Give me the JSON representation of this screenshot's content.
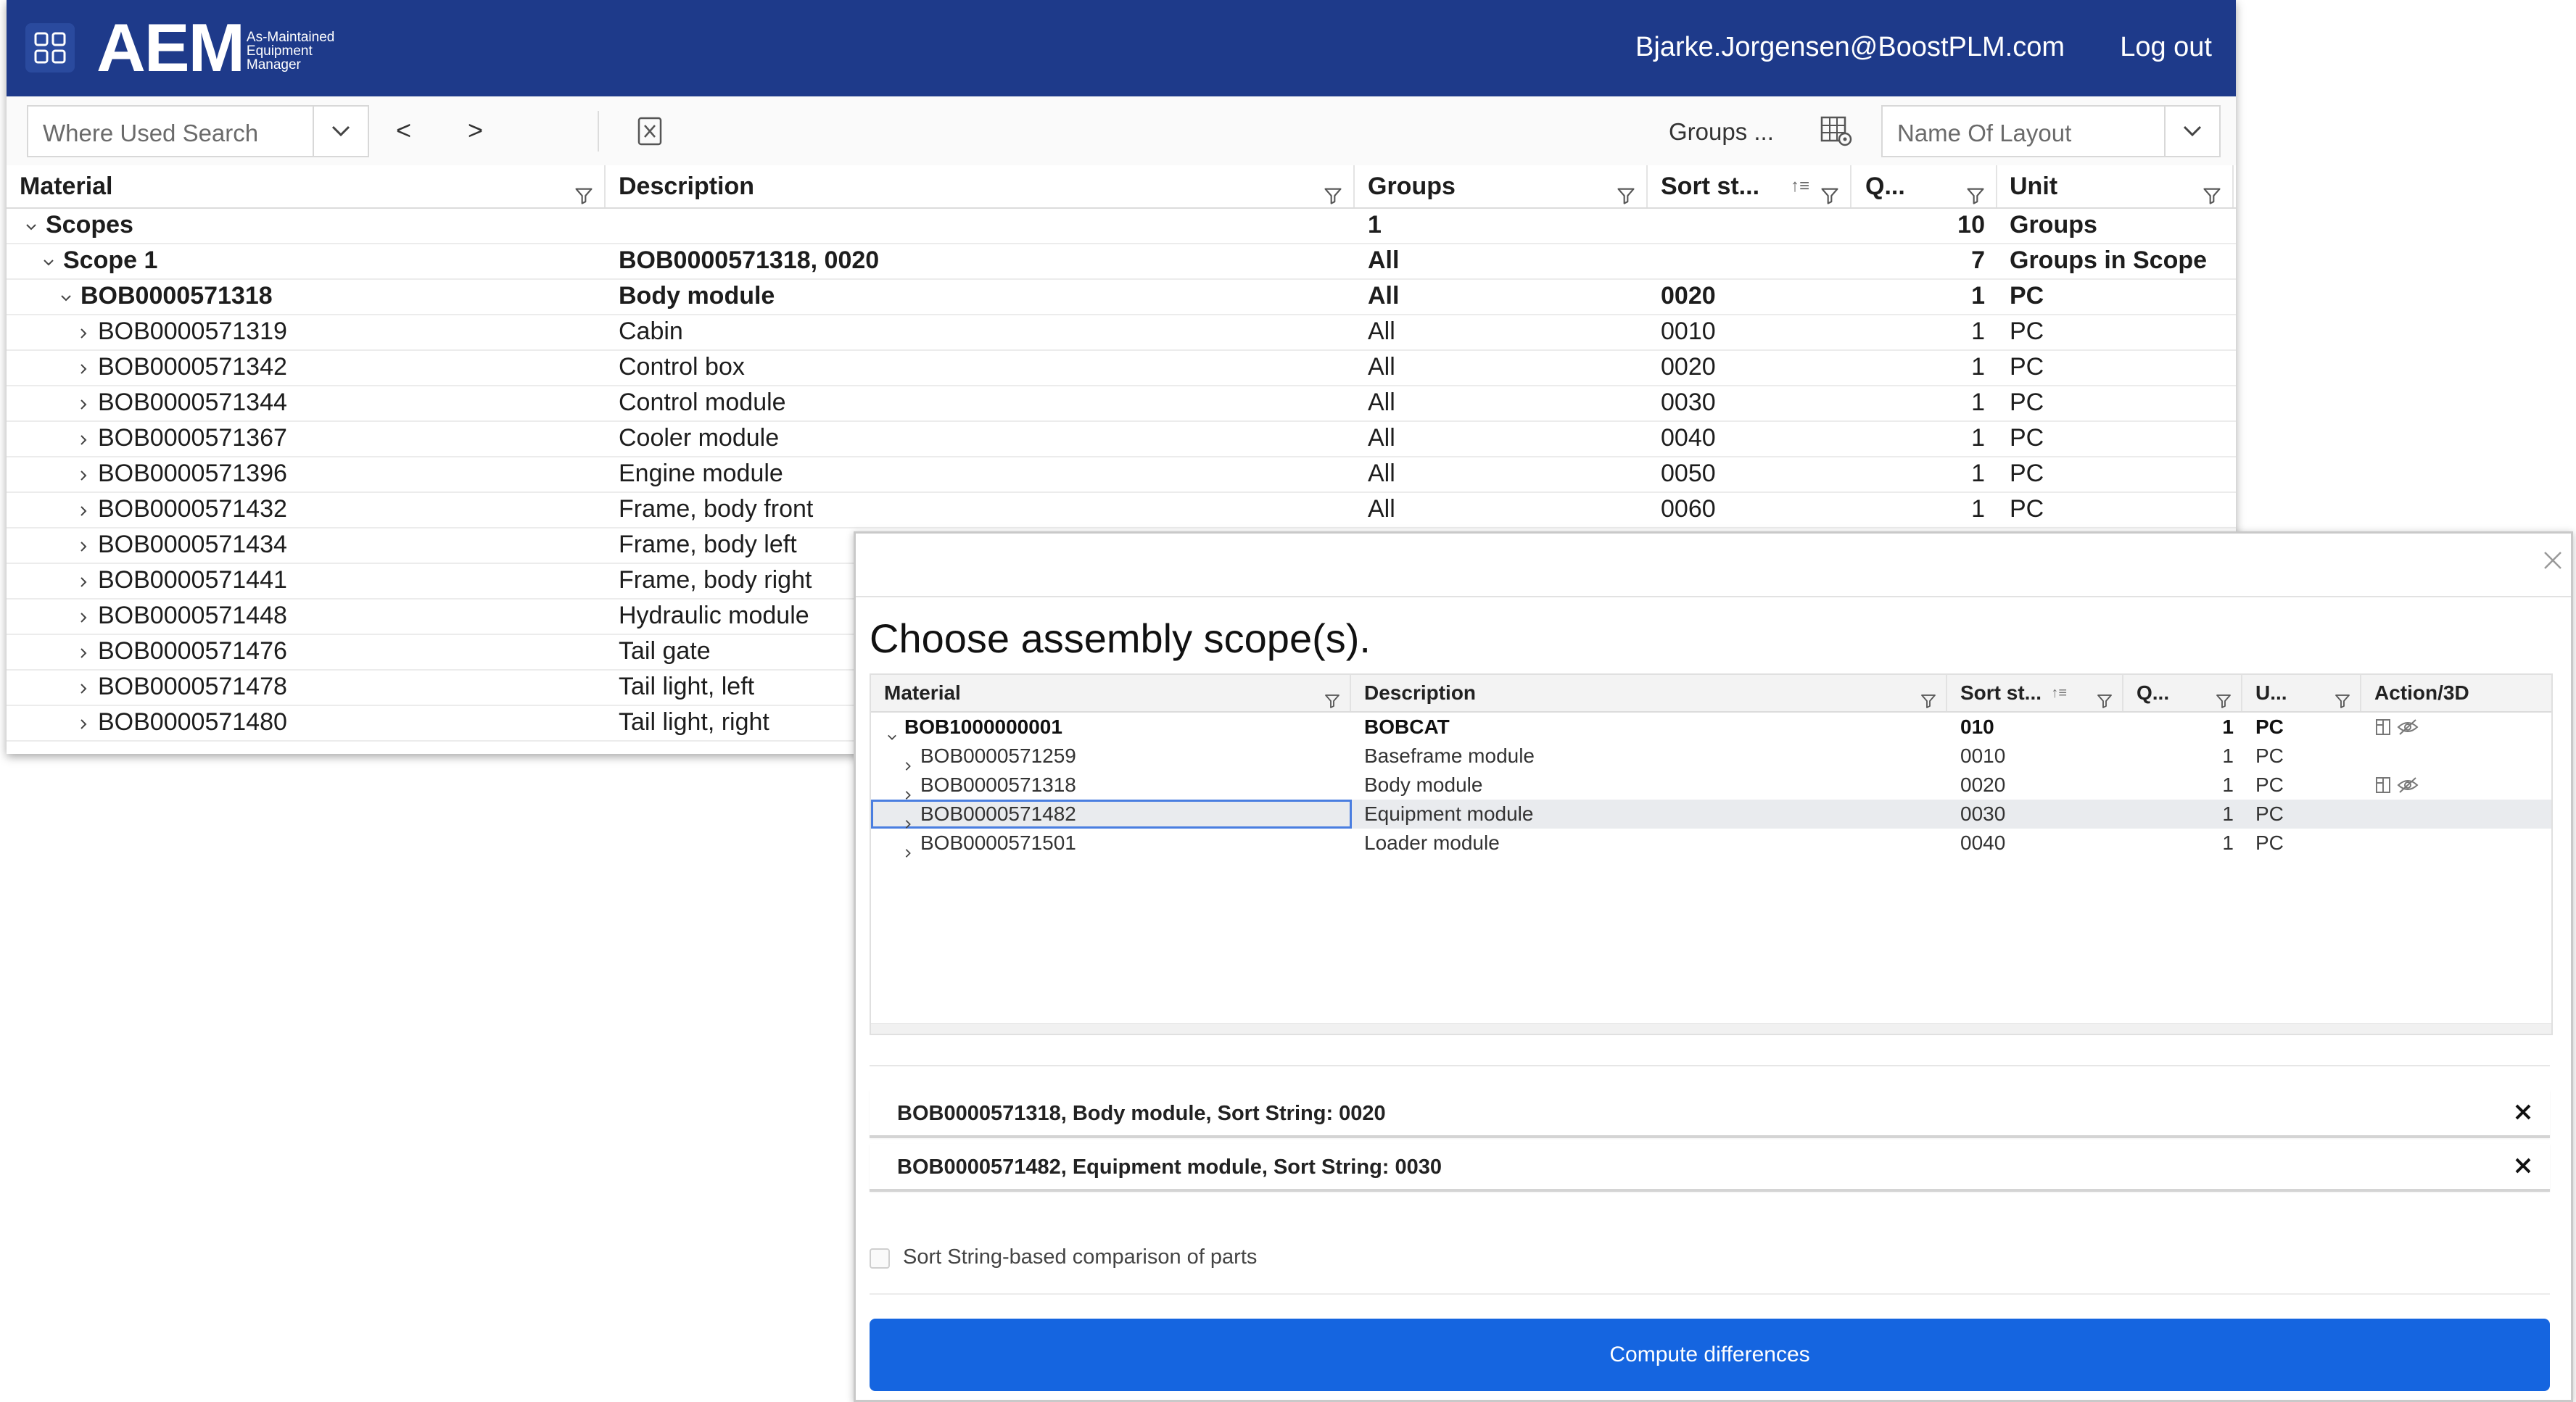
{
  "app": {
    "logo_text": "AEM",
    "logo_subtitle": [
      "As-Maintained",
      "Equipment",
      "Manager"
    ],
    "user_email": "Bjarke.Jorgensen@BoostPLM.com",
    "logout_label": "Log out",
    "brand_color": "#1e3a8a"
  },
  "toolbar": {
    "search_placeholder": "Where Used Search",
    "prev_label": "<",
    "next_label": ">",
    "groups_label": "Groups ...",
    "layout_placeholder": "Name Of Layout"
  },
  "grid": {
    "columns": [
      "Material",
      "Description",
      "Groups",
      "Sort st...",
      "Q...",
      "Unit"
    ],
    "rows": [
      {
        "material": "Scopes",
        "description": "",
        "groups": "1",
        "sort": "",
        "qty": "10",
        "unit": "Groups",
        "level": 0,
        "bold": true,
        "expanded": true
      },
      {
        "material": "Scope 1",
        "description": "BOB0000571318, 0020",
        "groups": "All",
        "sort": "",
        "qty": "7",
        "unit": "Groups in Scope",
        "level": 1,
        "bold": true,
        "expanded": true
      },
      {
        "material": "BOB0000571318",
        "description": "Body module",
        "groups": "All",
        "sort": "0020",
        "qty": "1",
        "unit": "PC",
        "level": 2,
        "bold": true,
        "expanded": true
      },
      {
        "material": "BOB0000571319",
        "description": "Cabin",
        "groups": "All",
        "sort": "0010",
        "qty": "1",
        "unit": "PC",
        "level": 3,
        "bold": false,
        "expanded": false
      },
      {
        "material": "BOB0000571342",
        "description": "Control box",
        "groups": "All",
        "sort": "0020",
        "qty": "1",
        "unit": "PC",
        "level": 3,
        "bold": false,
        "expanded": false
      },
      {
        "material": "BOB0000571344",
        "description": "Control module",
        "groups": "All",
        "sort": "0030",
        "qty": "1",
        "unit": "PC",
        "level": 3,
        "bold": false,
        "expanded": false
      },
      {
        "material": "BOB0000571367",
        "description": "Cooler module",
        "groups": "All",
        "sort": "0040",
        "qty": "1",
        "unit": "PC",
        "level": 3,
        "bold": false,
        "expanded": false
      },
      {
        "material": "BOB0000571396",
        "description": "Engine module",
        "groups": "All",
        "sort": "0050",
        "qty": "1",
        "unit": "PC",
        "level": 3,
        "bold": false,
        "expanded": false
      },
      {
        "material": "BOB0000571432",
        "description": "Frame, body front",
        "groups": "All",
        "sort": "0060",
        "qty": "1",
        "unit": "PC",
        "level": 3,
        "bold": false,
        "expanded": false
      },
      {
        "material": "BOB0000571434",
        "description": "Frame, body left",
        "groups": "",
        "sort": "",
        "qty": "",
        "unit": "",
        "level": 3,
        "bold": false,
        "expanded": false
      },
      {
        "material": "BOB0000571441",
        "description": "Frame, body right",
        "groups": "",
        "sort": "",
        "qty": "",
        "unit": "",
        "level": 3,
        "bold": false,
        "expanded": false
      },
      {
        "material": "BOB0000571448",
        "description": "Hydraulic module",
        "groups": "",
        "sort": "",
        "qty": "",
        "unit": "",
        "level": 3,
        "bold": false,
        "expanded": false
      },
      {
        "material": "BOB0000571476",
        "description": "Tail gate",
        "groups": "",
        "sort": "",
        "qty": "",
        "unit": "",
        "level": 3,
        "bold": false,
        "expanded": false
      },
      {
        "material": "BOB0000571478",
        "description": "Tail light, left",
        "groups": "",
        "sort": "",
        "qty": "",
        "unit": "",
        "level": 3,
        "bold": false,
        "expanded": false
      },
      {
        "material": "BOB0000571480",
        "description": "Tail light, right",
        "groups": "",
        "sort": "",
        "qty": "",
        "unit": "",
        "level": 3,
        "bold": false,
        "expanded": false
      }
    ]
  },
  "dialog": {
    "title": "Choose assembly scope(s).",
    "columns": [
      "Material",
      "Description",
      "Sort st...",
      "Q...",
      "U...",
      "Action/3D"
    ],
    "rows": [
      {
        "material": "BOB1000000001",
        "description": "BOBCAT",
        "sort": "010",
        "qty": "1",
        "unit": "PC",
        "level": 0,
        "bold": true,
        "expanded": true,
        "actions": true,
        "selected": false
      },
      {
        "material": "BOB0000571259",
        "description": "Baseframe module",
        "sort": "0010",
        "qty": "1",
        "unit": "PC",
        "level": 1,
        "bold": false,
        "expanded": false,
        "actions": false,
        "selected": false
      },
      {
        "material": "BOB0000571318",
        "description": "Body module",
        "sort": "0020",
        "qty": "1",
        "unit": "PC",
        "level": 1,
        "bold": false,
        "expanded": false,
        "actions": true,
        "selected": false
      },
      {
        "material": "BOB0000571482",
        "description": "Equipment module",
        "sort": "0030",
        "qty": "1",
        "unit": "PC",
        "level": 1,
        "bold": false,
        "expanded": false,
        "actions": false,
        "selected": true
      },
      {
        "material": "BOB0000571501",
        "description": "Loader module",
        "sort": "0040",
        "qty": "1",
        "unit": "PC",
        "level": 1,
        "bold": false,
        "expanded": false,
        "actions": false,
        "selected": false
      }
    ],
    "selected_scopes": [
      "BOB0000571318, Body module, Sort String: 0020",
      "BOB0000571482, Equipment module, Sort String: 0030"
    ],
    "checkbox_label": "Sort String-based comparison of parts",
    "checkbox_checked": false,
    "compute_label": "Compute differences",
    "compute_color": "#1565e0"
  }
}
